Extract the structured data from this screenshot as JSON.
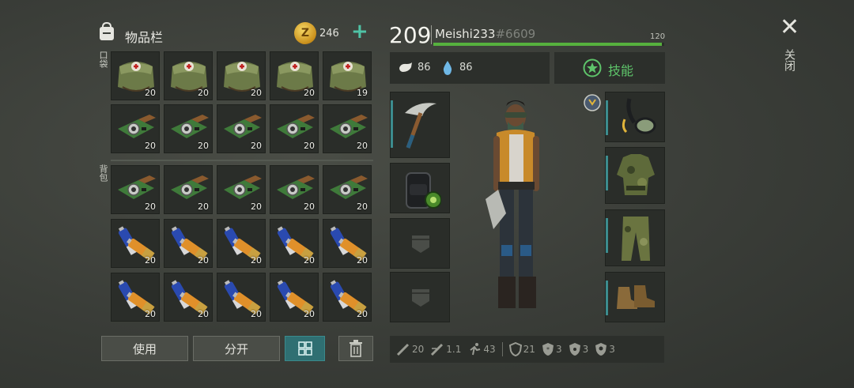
{
  "inventory": {
    "title": "物品栏",
    "coins": "246",
    "pocket_label": "口袋",
    "backpack_label": "背包",
    "pocket_rows": [
      [
        {
          "item": "medkit-bag",
          "count": "20"
        },
        {
          "item": "medkit-bag",
          "count": "20"
        },
        {
          "item": "medkit-bag",
          "count": "20"
        },
        {
          "item": "medkit-bag",
          "count": "20"
        },
        {
          "item": "medkit-bag",
          "count": "19"
        }
      ],
      [
        {
          "item": "circuit-board",
          "count": "20"
        },
        {
          "item": "circuit-board",
          "count": "20"
        },
        {
          "item": "circuit-board",
          "count": "20"
        },
        {
          "item": "circuit-board",
          "count": "20"
        },
        {
          "item": "circuit-board",
          "count": "20"
        }
      ]
    ],
    "backpack_rows": [
      [
        {
          "item": "circuit-board",
          "count": "20"
        },
        {
          "item": "circuit-board",
          "count": "20"
        },
        {
          "item": "circuit-board",
          "count": "20"
        },
        {
          "item": "circuit-board",
          "count": "20"
        },
        {
          "item": "circuit-board",
          "count": "20"
        }
      ],
      [
        {
          "item": "batteries",
          "count": "20"
        },
        {
          "item": "batteries",
          "count": "20"
        },
        {
          "item": "batteries",
          "count": "20"
        },
        {
          "item": "batteries",
          "count": "20"
        },
        {
          "item": "batteries",
          "count": "20"
        }
      ],
      [
        {
          "item": "batteries",
          "count": "20"
        },
        {
          "item": "batteries",
          "count": "20"
        },
        {
          "item": "batteries",
          "count": "20"
        },
        {
          "item": "batteries",
          "count": "20"
        },
        {
          "item": "batteries",
          "count": "20"
        }
      ]
    ],
    "use_label": "使用",
    "split_label": "分开"
  },
  "character": {
    "level": "209",
    "name": "Meishi233",
    "id": "#6609",
    "xp_max": "120",
    "xp_fraction": 0.99,
    "hunger": "86",
    "thirst": "86",
    "skills_label": "技能"
  },
  "stats": {
    "damage": "20",
    "attack_speed": "1.1",
    "speed": "43",
    "defense": "21",
    "cold_res": "3",
    "radiation_res": "3",
    "toxic_res": "3"
  },
  "close_label": "关闭",
  "colors": {
    "accent": "#3c8c8e",
    "xp": "#56b13e",
    "coin": "#e0b43a"
  }
}
